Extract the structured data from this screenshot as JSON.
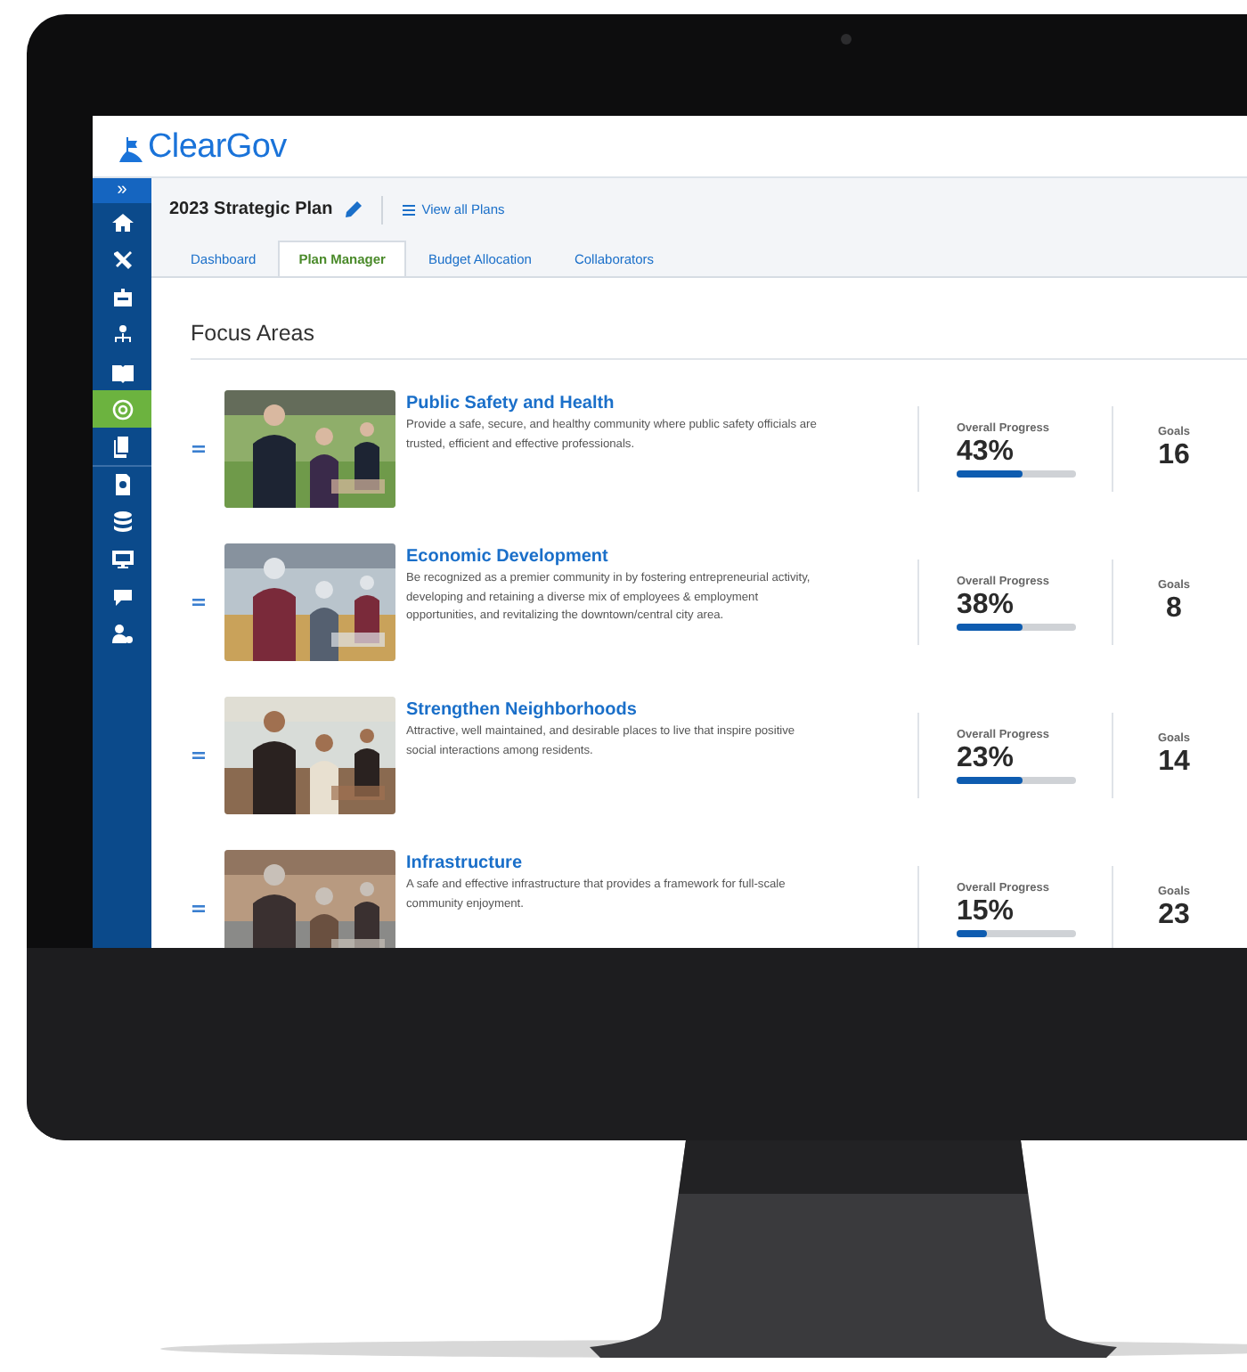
{
  "logo": {
    "text": "ClearGov"
  },
  "sidebar": {
    "toggle": "»",
    "items": [
      {
        "selected": false
      },
      {
        "selected": false
      },
      {
        "selected": false
      },
      {
        "selected": false
      },
      {
        "selected": false
      },
      {
        "selected": true
      },
      {
        "selected": false
      },
      {
        "selected": false
      },
      {
        "selected": false
      },
      {
        "selected": false
      },
      {
        "selected": false
      },
      {
        "selected": false
      }
    ]
  },
  "plan": {
    "title": "2023 Strategic Plan",
    "view_all": "View all  Plans"
  },
  "tabs": [
    {
      "label": "Dashboard",
      "selected": false
    },
    {
      "label": "Plan Manager",
      "selected": true
    },
    {
      "label": "Budget Allocation",
      "selected": false
    },
    {
      "label": "Collaborators",
      "selected": false
    }
  ],
  "section_title": "Focus Areas",
  "focus_areas": [
    {
      "title": "Public Safety and Health",
      "description": "Provide a safe, secure, and healthy community where public safety officials are trusted, efficient and effective professionals.",
      "progress_label": "Overall Progress",
      "progress": "43%",
      "level": 0.55,
      "goals_label": "Goals",
      "goals": "16"
    },
    {
      "title": "Economic Development",
      "description": "Be recognized as a premier community in by fostering entrepreneurial activity, developing and retaining a diverse mix of employees & employment opportunities, and revitalizing the downtown/central city area.",
      "progress_label": "Overall Progress",
      "progress": "38%",
      "level": 0.55,
      "goals_label": "Goals",
      "goals": "8"
    },
    {
      "title": "Strengthen Neighborhoods",
      "description": "Attractive, well maintained, and desirable places to live that inspire positive social interactions among residents.",
      "progress_label": "Overall Progress",
      "progress": "23%",
      "level": 0.55,
      "goals_label": "Goals",
      "goals": "14"
    },
    {
      "title": "Infrastructure",
      "description": "A safe and effective infrastructure that provides a framework for full-scale community enjoyment.",
      "progress_label": "Overall Progress",
      "progress": "15%",
      "level": 0.25,
      "goals_label": "Goals",
      "goals": "23"
    }
  ]
}
